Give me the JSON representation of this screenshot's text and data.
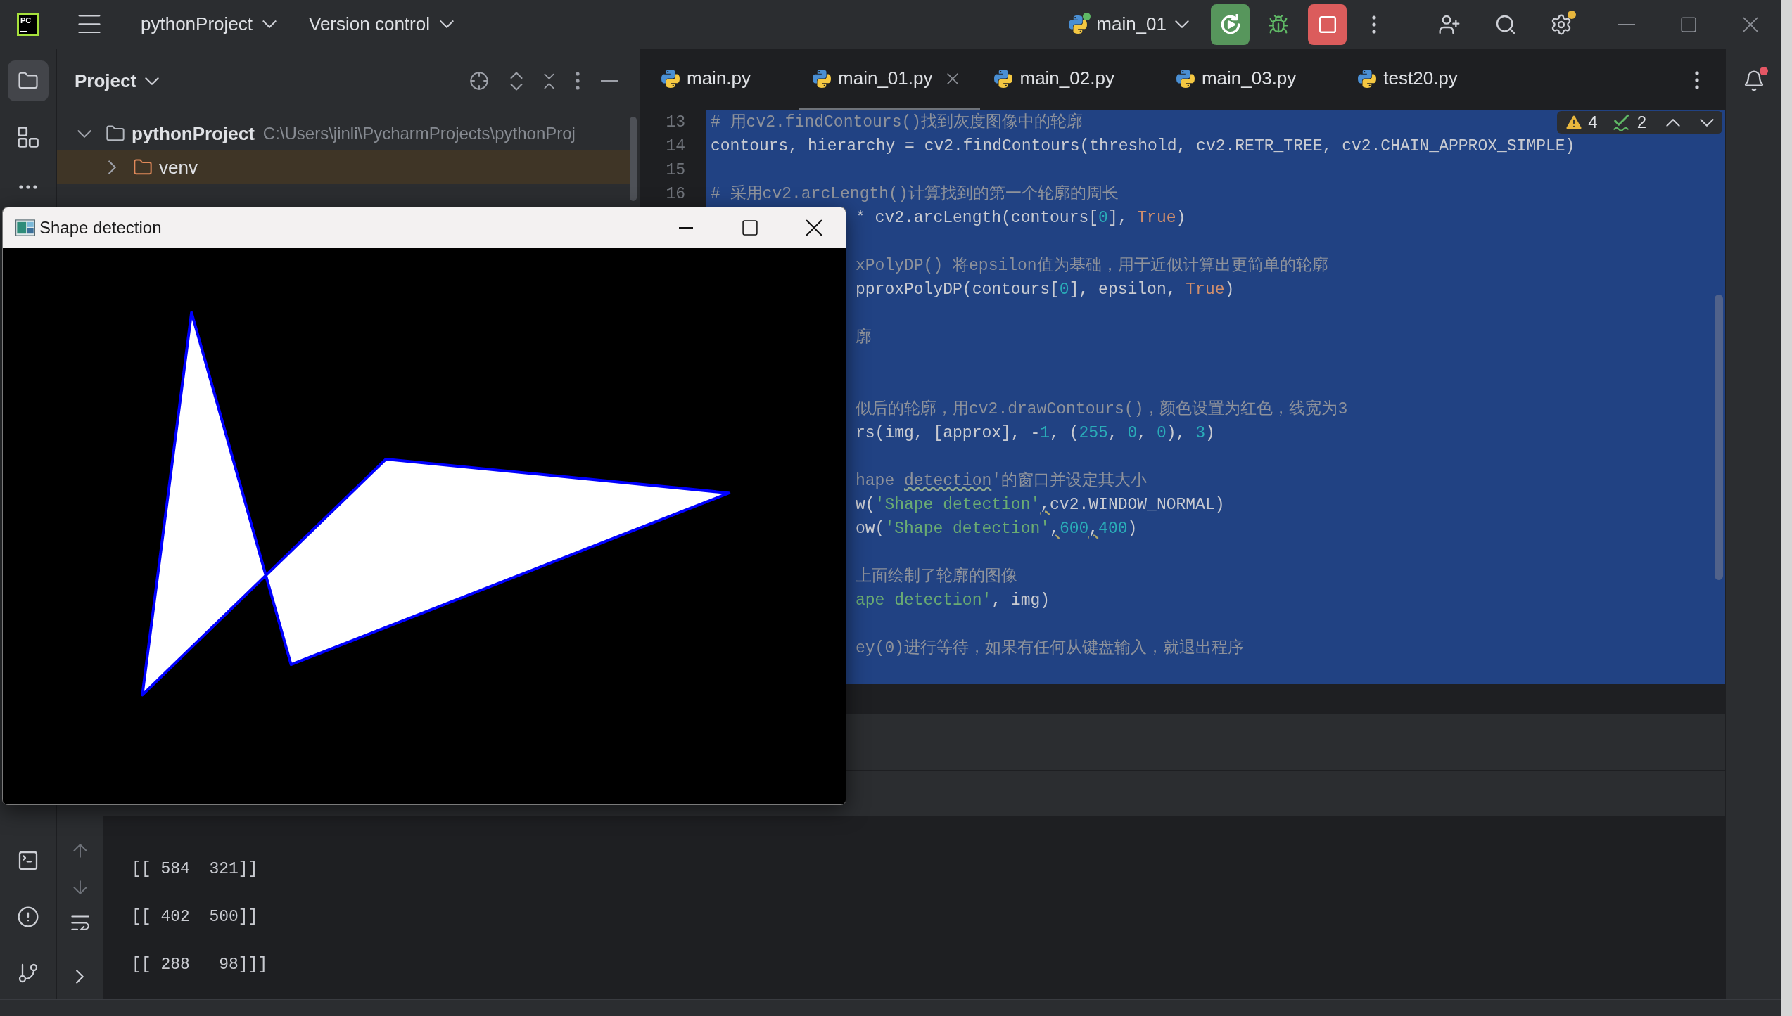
{
  "main_toolbar": {
    "logo": "PC",
    "project": "pythonProject",
    "vcs": "Version control",
    "run_config": {
      "label": "main_01",
      "running": true
    },
    "settings_badge": true
  },
  "tool_strip": [
    {
      "selected": true
    },
    {
      "selected": false
    },
    {
      "selected": false
    }
  ],
  "project_panel": {
    "title": "Project",
    "tree": [
      {
        "name": "pythonProject",
        "path": "C:\\Users\\jinli\\PycharmProjects\\pythonProj",
        "kind": "root",
        "expanded": true,
        "selected": false,
        "children": [
          {
            "name": "venv",
            "kind": "excluded",
            "expanded": false,
            "selected": true
          }
        ]
      }
    ]
  },
  "tabs": [
    {
      "label": "main.py",
      "selected": false
    },
    {
      "label": "main_01.py",
      "selected": true
    },
    {
      "label": "main_02.py",
      "selected": false
    },
    {
      "label": "main_03.py",
      "selected": false
    },
    {
      "label": "test20.py",
      "selected": false
    }
  ],
  "inspections": {
    "warnings": "4",
    "weak_warnings": "2"
  },
  "editor": {
    "lines": [
      {
        "kind": "code",
        "number": "13",
        "selected": true,
        "partial": false,
        "tokens": [
          {
            "kind": "comment",
            "text": "# 用cv2.findContours()找到灰度图像中的轮廓"
          }
        ]
      },
      {
        "kind": "code",
        "number": "14",
        "selected": true,
        "partial": false,
        "tokens": [
          {
            "kind": "plain",
            "text": "contours, hierarchy = cv2.findContours(threshold, cv2.RETR_TREE, cv2.CHAIN_APPROX_SIMPLE)"
          }
        ]
      },
      {
        "kind": "blank",
        "number": "15",
        "selected": true
      },
      {
        "kind": "code",
        "number": "16",
        "selected": true,
        "partial": false,
        "tokens": [
          {
            "kind": "comment",
            "text": "# 采用cv2.arcLength()计算找到的第一个轮廓的周长"
          }
        ]
      },
      {
        "kind": "code",
        "selected": true,
        "partial": true,
        "tokens": [
          {
            "kind": "plain",
            "text": "* cv2.arcLength(contours["
          },
          {
            "kind": "number",
            "text": "0"
          },
          {
            "kind": "plain",
            "text": "], "
          },
          {
            "kind": "keyword",
            "text": "True"
          },
          {
            "kind": "plain",
            "text": ")"
          }
        ]
      },
      {
        "kind": "blank",
        "selected": true
      },
      {
        "kind": "code",
        "selected": true,
        "partial": true,
        "tokens": [
          {
            "kind": "comment",
            "text": "xPolyDP() 将epsilon值为基础，用于近似计算出更简单的轮廓"
          }
        ]
      },
      {
        "kind": "code",
        "selected": true,
        "partial": true,
        "tokens": [
          {
            "kind": "plain",
            "text": "pproxPolyDP(contours["
          },
          {
            "kind": "number",
            "text": "0"
          },
          {
            "kind": "plain",
            "text": "], epsilon, "
          },
          {
            "kind": "keyword",
            "text": "True"
          },
          {
            "kind": "plain",
            "text": ")"
          }
        ]
      },
      {
        "kind": "blank",
        "selected": true
      },
      {
        "kind": "code",
        "selected": true,
        "partial": true,
        "tokens": [
          {
            "kind": "comment",
            "text": "廓"
          }
        ]
      },
      {
        "kind": "blank",
        "selected": true
      },
      {
        "kind": "blank",
        "selected": true
      },
      {
        "kind": "code",
        "selected": true,
        "partial": true,
        "tokens": [
          {
            "kind": "comment",
            "text": "似后的轮廓，用cv2.drawContours()，颜色设置为红色，线宽为3"
          }
        ]
      },
      {
        "kind": "code",
        "selected": true,
        "partial": true,
        "tokens": [
          {
            "kind": "plain",
            "text": "rs(img, [approx], -"
          },
          {
            "kind": "number",
            "text": "1"
          },
          {
            "kind": "plain",
            "text": ", ("
          },
          {
            "kind": "number",
            "text": "255"
          },
          {
            "kind": "plain",
            "text": ", "
          },
          {
            "kind": "number",
            "text": "0"
          },
          {
            "kind": "plain",
            "text": ", "
          },
          {
            "kind": "number",
            "text": "0"
          },
          {
            "kind": "plain",
            "text": "), "
          },
          {
            "kind": "number",
            "text": "3"
          },
          {
            "kind": "plain",
            "text": ")"
          }
        ]
      },
      {
        "kind": "blank",
        "selected": true
      },
      {
        "kind": "code",
        "selected": true,
        "partial": true,
        "tokens": [
          {
            "kind": "comment",
            "text": "hape "
          },
          {
            "kind": "comment_typo",
            "text": "detection"
          },
          {
            "kind": "comment",
            "text": "'的窗口并设定其大小"
          }
        ]
      },
      {
        "kind": "code",
        "selected": true,
        "partial": true,
        "tokens": [
          {
            "kind": "plain",
            "text": "w("
          },
          {
            "kind": "string",
            "text": "'Shape detection'"
          },
          {
            "kind": "plain_lead_warn",
            "text": ",cv2.WINDOW_NORMAL)"
          }
        ]
      },
      {
        "kind": "code",
        "selected": true,
        "partial": true,
        "tokens": [
          {
            "kind": "plain",
            "text": "ow("
          },
          {
            "kind": "string",
            "text": "'Shape detection'"
          },
          {
            "kind": "plain_warn",
            "text": ","
          },
          {
            "kind": "number",
            "text": "600"
          },
          {
            "kind": "plain_warn",
            "text": ","
          },
          {
            "kind": "number",
            "text": "400"
          },
          {
            "kind": "plain",
            "text": ")"
          }
        ]
      },
      {
        "kind": "blank",
        "selected": true
      },
      {
        "kind": "code",
        "selected": true,
        "partial": true,
        "tokens": [
          {
            "kind": "comment",
            "text": "上面绘制了轮廓的图像"
          }
        ]
      },
      {
        "kind": "code",
        "selected": true,
        "partial": true,
        "tokens": [
          {
            "kind": "string",
            "text": "ape detection'"
          },
          {
            "kind": "plain",
            "text": ", img)"
          }
        ]
      },
      {
        "kind": "blank",
        "selected": true
      },
      {
        "kind": "code",
        "selected": true,
        "partial": true,
        "tokens": [
          {
            "kind": "comment",
            "text": "ey(0)进行等待，如果有任何从键盘输入，就退出程序"
          }
        ]
      },
      {
        "kind": "blank",
        "selected": true
      }
    ]
  },
  "console": {
    "lines": [
      "[[ 584  321]]",
      "[[ 402  500]]",
      "[[ 288   98]]]"
    ]
  },
  "notifications": {
    "unread": true
  },
  "image_window": {
    "title": "Shape detection"
  }
}
